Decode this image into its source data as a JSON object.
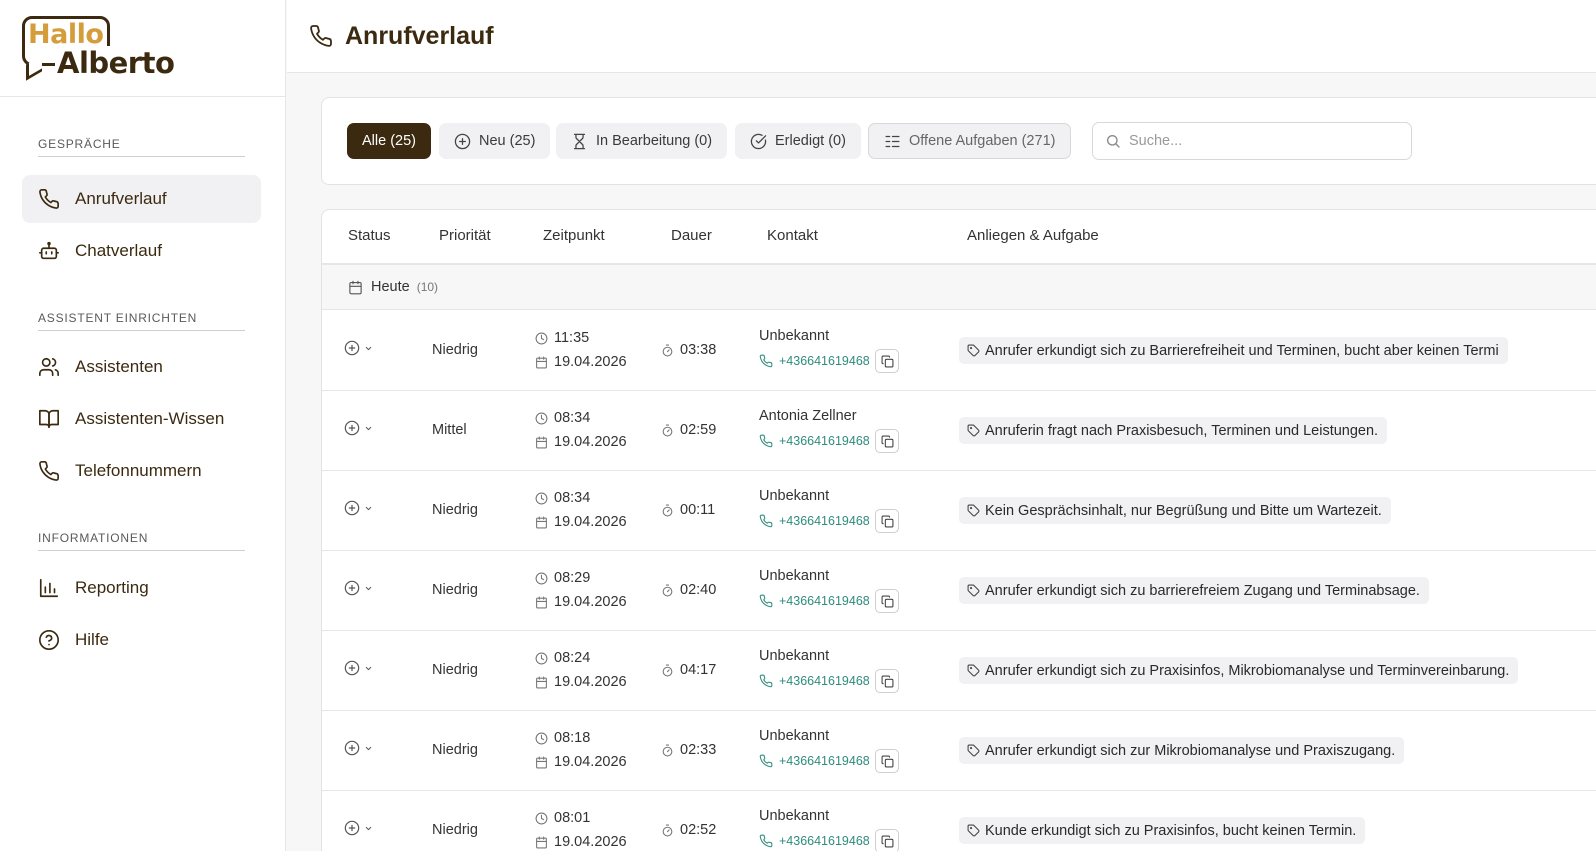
{
  "brand": {
    "logo_line1": "Hallo",
    "logo_line2": "Alberto"
  },
  "sidebar": {
    "sections": [
      {
        "title": "GESPRÄCHE"
      },
      {
        "title": "ASSISTENT EINRICHTEN"
      },
      {
        "title": "INFORMATIONEN"
      }
    ],
    "items": [
      {
        "label": "Anrufverlauf",
        "icon": "phone-icon",
        "active": true
      },
      {
        "label": "Chatverlauf",
        "icon": "bot-icon"
      },
      {
        "label": "Assistenten",
        "icon": "users-icon"
      },
      {
        "label": "Assistenten-Wissen",
        "icon": "book-icon"
      },
      {
        "label": "Telefonnummern",
        "icon": "phone-icon"
      },
      {
        "label": "Reporting",
        "icon": "bar-chart-icon"
      },
      {
        "label": "Hilfe",
        "icon": "help-circle-icon"
      }
    ]
  },
  "header": {
    "title": "Anrufverlauf",
    "icon": "phone-icon"
  },
  "filters": {
    "chips": [
      {
        "label": "Alle (25)",
        "active": true
      },
      {
        "label": "Neu (25)",
        "icon": "plus-circle-icon"
      },
      {
        "label": "In Bearbeitung (0)",
        "icon": "hourglass-icon"
      },
      {
        "label": "Erledigt (0)",
        "icon": "check-circle-icon"
      },
      {
        "label": "Offene Aufgaben (271)",
        "icon": "list-checks-icon"
      }
    ],
    "search_placeholder": "Suche..."
  },
  "table": {
    "columns": [
      "Status",
      "Priorität",
      "Zeitpunkt",
      "Dauer",
      "Kontakt",
      "Anliegen & Aufgabe"
    ],
    "group": {
      "title": "Heute",
      "count": "(10)"
    },
    "rows": [
      {
        "priority": "Niedrig",
        "time": "11:35",
        "date": "19.04.2026",
        "duration": "03:38",
        "contact": "Unbekannt",
        "phone": "+436641619468",
        "concern": "Anrufer erkundigt sich zu Barrierefreiheit und Terminen, bucht aber keinen Termi"
      },
      {
        "priority": "Mittel",
        "time": "08:34",
        "date": "19.04.2026",
        "duration": "02:59",
        "contact": "Antonia Zellner",
        "phone": "+436641619468",
        "concern": "Anruferin fragt nach Praxisbesuch, Terminen und Leistungen."
      },
      {
        "priority": "Niedrig",
        "time": "08:34",
        "date": "19.04.2026",
        "duration": "00:11",
        "contact": "Unbekannt",
        "phone": "+436641619468",
        "concern": "Kein Gesprächsinhalt, nur Begrüßung und Bitte um Wartezeit."
      },
      {
        "priority": "Niedrig",
        "time": "08:29",
        "date": "19.04.2026",
        "duration": "02:40",
        "contact": "Unbekannt",
        "phone": "+436641619468",
        "concern": "Anrufer erkundigt sich zu barrierefreiem Zugang und Terminabsage."
      },
      {
        "priority": "Niedrig",
        "time": "08:24",
        "date": "19.04.2026",
        "duration": "04:17",
        "contact": "Unbekannt",
        "phone": "+436641619468",
        "concern": "Anrufer erkundigt sich zu Praxisinfos, Mikrobiomanalyse und Terminvereinbarung."
      },
      {
        "priority": "Niedrig",
        "time": "08:18",
        "date": "19.04.2026",
        "duration": "02:33",
        "contact": "Unbekannt",
        "phone": "+436641619468",
        "concern": "Anrufer erkundigt sich zur Mikrobiomanalyse und Praxiszugang."
      },
      {
        "priority": "Niedrig",
        "time": "08:01",
        "date": "19.04.2026",
        "duration": "02:52",
        "contact": "Unbekannt",
        "phone": "+436641619468",
        "concern": "Kunde erkundigt sich zu Praxisinfos, bucht keinen Termin."
      }
    ]
  }
}
